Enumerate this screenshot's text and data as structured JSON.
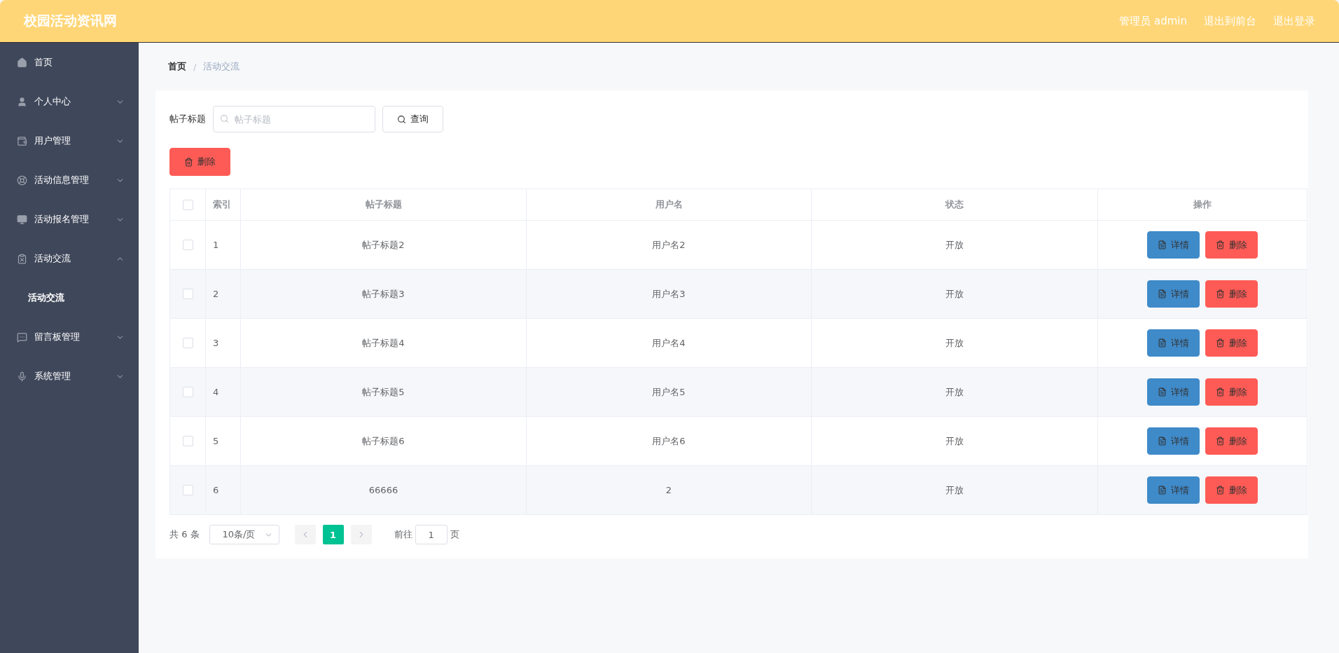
{
  "header": {
    "title": "校园活动资讯网",
    "links": [
      "管理员 admin",
      "退出到前台",
      "退出登录"
    ]
  },
  "sidebar": {
    "items": [
      {
        "kind": "link",
        "label": "首页"
      },
      {
        "kind": "submenu",
        "label": "个人中心",
        "expanded": false
      },
      {
        "kind": "submenu",
        "label": "用户管理",
        "expanded": false
      },
      {
        "kind": "submenu",
        "label": "活动信息管理",
        "expanded": false
      },
      {
        "kind": "submenu",
        "label": "活动报名管理",
        "expanded": false
      },
      {
        "kind": "submenu",
        "label": "活动交流",
        "expanded": true,
        "children": [
          {
            "label": "活动交流",
            "selected": true
          }
        ]
      },
      {
        "kind": "submenu",
        "label": "留言板管理",
        "expanded": false
      },
      {
        "kind": "submenu",
        "label": "系统管理",
        "expanded": false
      }
    ]
  },
  "breadcrumb": {
    "items": [
      "首页",
      "活动交流"
    ],
    "separator": "/"
  },
  "search": {
    "label": "帖子标题",
    "placeholder": "帖子标题",
    "button": "查询"
  },
  "bulk_delete": "删除",
  "table": {
    "header_checked": false,
    "columns": [
      "索引",
      "帖子标题",
      "用户名",
      "状态",
      "操作"
    ],
    "rows": [
      {
        "checked": false,
        "index": "1",
        "title": "帖子标题2",
        "user": "用户名2",
        "status": "开放",
        "actions": [
          "详情",
          "删除"
        ]
      },
      {
        "checked": false,
        "index": "2",
        "title": "帖子标题3",
        "user": "用户名3",
        "status": "开放",
        "actions": [
          "详情",
          "删除"
        ]
      },
      {
        "checked": false,
        "index": "3",
        "title": "帖子标题4",
        "user": "用户名4",
        "status": "开放",
        "actions": [
          "详情",
          "删除"
        ]
      },
      {
        "checked": false,
        "index": "4",
        "title": "帖子标题5",
        "user": "用户名5",
        "status": "开放",
        "actions": [
          "详情",
          "删除"
        ]
      },
      {
        "checked": false,
        "index": "5",
        "title": "帖子标题6",
        "user": "用户名6",
        "status": "开放",
        "actions": [
          "详情",
          "删除"
        ]
      },
      {
        "checked": false,
        "index": "6",
        "title": "66666",
        "user": "2",
        "status": "开放",
        "actions": [
          "详情",
          "删除"
        ]
      }
    ]
  },
  "pagination": {
    "total": "共 6 条",
    "page_size": "10条/页",
    "pages": [
      {
        "label": "1",
        "selected": true
      }
    ],
    "goto_label": "前往",
    "goto_value": "1",
    "goto_suffix": "页"
  }
}
